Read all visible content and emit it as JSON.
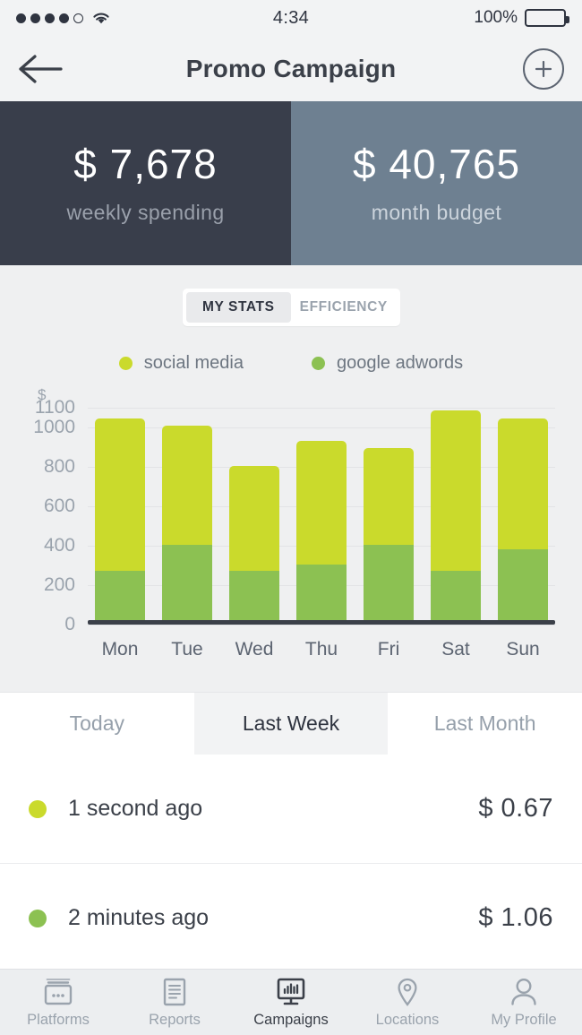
{
  "status_bar": {
    "signal_dots_filled": 4,
    "signal_dots_total": 5,
    "wifi_icon": "wifi-icon",
    "time": "4:34",
    "battery_percent": "100%",
    "battery_icon": "battery-full-icon"
  },
  "header": {
    "back_icon": "arrow-left-icon",
    "title": "Promo Campaign",
    "add_icon": "plus-circle-icon"
  },
  "stat_cards": [
    {
      "amount": "$ 7,678",
      "label": "weekly spending",
      "bg": "#393e4b"
    },
    {
      "amount": "$ 40,765",
      "label": "month budget",
      "bg": "#6e8091"
    }
  ],
  "segmented_control": {
    "options": [
      "MY STATS",
      "EFFICIENCY"
    ],
    "selected": "MY STATS"
  },
  "legend": [
    {
      "label": "social media",
      "color": "#cada2c"
    },
    {
      "label": "google adwords",
      "color": "#8cc152"
    }
  ],
  "chart_data": {
    "type": "bar",
    "stacked": true,
    "title": "",
    "xlabel": "",
    "ylabel": "$",
    "categories": [
      "Mon",
      "Tue",
      "Wed",
      "Thu",
      "Fri",
      "Sat",
      "Sun"
    ],
    "yticks": [
      0,
      200,
      400,
      600,
      800,
      1000,
      1100
    ],
    "ylim": [
      0,
      1100
    ],
    "grid": true,
    "legend_position": "top",
    "series": [
      {
        "name": "google adwords",
        "color": "#8cc152",
        "values": [
          255,
          390,
          255,
          290,
          390,
          255,
          365
        ]
      },
      {
        "name": "social media",
        "color": "#cada2c",
        "values": [
          790,
          615,
          545,
          640,
          500,
          830,
          680
        ]
      }
    ],
    "totals": [
      1045,
      1005,
      800,
      930,
      890,
      1085,
      1045
    ]
  },
  "period_tabs": {
    "options": [
      "Today",
      "Last Week",
      "Last Month"
    ],
    "selected": "Last Week"
  },
  "transactions": [
    {
      "dot_color": "#cada2c",
      "time": "1 second ago",
      "amount": "$ 0.67"
    },
    {
      "dot_color": "#8cc152",
      "time": "2 minutes ago",
      "amount": "$ 1.06"
    }
  ],
  "bottom_nav": {
    "items": [
      {
        "label": "Platforms",
        "icon": "platforms-icon",
        "active": false
      },
      {
        "label": "Reports",
        "icon": "document-lines-icon",
        "active": false
      },
      {
        "label": "Campaigns",
        "icon": "monitor-chart-icon",
        "active": true
      },
      {
        "label": "Locations",
        "icon": "map-pin-icon",
        "active": false
      },
      {
        "label": "My Profile",
        "icon": "user-icon",
        "active": false
      }
    ]
  },
  "colors": {
    "accent_yellow_green": "#cada2c",
    "accent_green": "#8cc152",
    "dark_slate": "#393e4b",
    "blue_gray": "#6e8091",
    "page_bg": "#eff0f1"
  }
}
